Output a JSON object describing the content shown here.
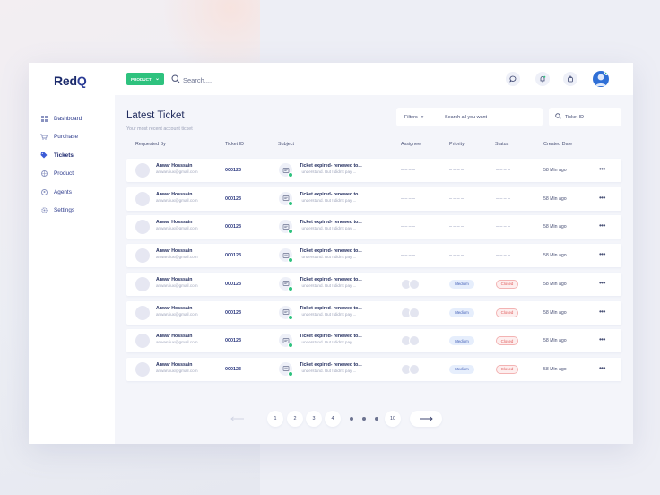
{
  "app": {
    "logo": "RedQ"
  },
  "sidebar": {
    "items": [
      {
        "label": "Dashboard",
        "icon": "grid-icon",
        "active": false
      },
      {
        "label": "Purchase",
        "icon": "cart-icon",
        "active": false
      },
      {
        "label": "Tickets",
        "icon": "tag-icon",
        "active": true
      },
      {
        "label": "Product",
        "icon": "box-icon",
        "active": false
      },
      {
        "label": "Agents",
        "icon": "agent-icon",
        "active": false
      },
      {
        "label": "Settings",
        "icon": "gear-icon",
        "active": false
      }
    ]
  },
  "topbar": {
    "product_label": "PRODUCT",
    "search_placeholder": "Search....",
    "icons": [
      "chat-icon",
      "notification-icon",
      "bag-icon"
    ]
  },
  "main": {
    "title": "Latest Ticket",
    "subtitle": "Your most recent account ticket",
    "filters_label": "Filters",
    "search_all_placeholder": "Search all you want",
    "ticket_id_placeholder": "Ticket ID"
  },
  "table": {
    "columns": [
      "Requested By",
      "Ticket ID",
      "Subject",
      "Assignee",
      "Priority",
      "Status",
      "Created Date"
    ],
    "rows": [
      {
        "name": "Anwar Hosssain",
        "email": "anwaruiux@gmail.com",
        "ticket_id": "000123",
        "subject": "Ticket expired- renewed to...",
        "subject_detail": "I understand. But I didn't pay ...",
        "assigned": false,
        "priority": "",
        "status": "",
        "time": "58 Min ago"
      },
      {
        "name": "Anwar Hosssain",
        "email": "anwaruiux@gmail.com",
        "ticket_id": "000123",
        "subject": "Ticket expired- renewed to...",
        "subject_detail": "I understand. But I didn't pay ...",
        "assigned": false,
        "priority": "",
        "status": "",
        "time": "58 Min ago"
      },
      {
        "name": "Anwar Hosssain",
        "email": "anwaruiux@gmail.com",
        "ticket_id": "000123",
        "subject": "Ticket expired- renewed to...",
        "subject_detail": "I understand. But I didn't pay ...",
        "assigned": false,
        "priority": "",
        "status": "",
        "time": "58 Min ago"
      },
      {
        "name": "Anwar Hosssain",
        "email": "anwaruiux@gmail.com",
        "ticket_id": "000123",
        "subject": "Ticket expired- renewed to...",
        "subject_detail": "I understand. But I didn't pay ...",
        "assigned": false,
        "priority": "",
        "status": "",
        "time": "58 Min ago"
      },
      {
        "name": "Anwar Hosssain",
        "email": "anwaruiux@gmail.com",
        "ticket_id": "000123",
        "subject": "Ticket expired- renewed to...",
        "subject_detail": "I understand. But I didn't pay ...",
        "assigned": true,
        "priority": "Medium",
        "status": "Closed",
        "time": "58 Min ago"
      },
      {
        "name": "Anwar Hosssain",
        "email": "anwaruiux@gmail.com",
        "ticket_id": "000123",
        "subject": "Ticket expired- renewed to...",
        "subject_detail": "I understand. But I didn't pay ...",
        "assigned": true,
        "priority": "Medium",
        "status": "Closed",
        "time": "58 Min ago"
      },
      {
        "name": "Anwar Hosssain",
        "email": "anwaruiux@gmail.com",
        "ticket_id": "000123",
        "subject": "Ticket expired- renewed to...",
        "subject_detail": "I understand. But I didn't pay ...",
        "assigned": true,
        "priority": "Medium",
        "status": "Closed",
        "time": "58 Min ago"
      },
      {
        "name": "Anwar Hosssain",
        "email": "anwaruiux@gmail.com",
        "ticket_id": "000123",
        "subject": "Ticket expired- renewed to...",
        "subject_detail": "I understand. But I didn't pay ...",
        "assigned": true,
        "priority": "Medium",
        "status": "Closed",
        "time": "58 Min ago"
      }
    ]
  },
  "pagination": {
    "pages": [
      "1",
      "2",
      "3",
      "4"
    ],
    "last_page": "10"
  },
  "colors": {
    "accent_green": "#2ec27e",
    "brand_navy": "#1b2a6b",
    "closed_red": "#e05b5b",
    "medium_blue": "#3d5bb5"
  }
}
